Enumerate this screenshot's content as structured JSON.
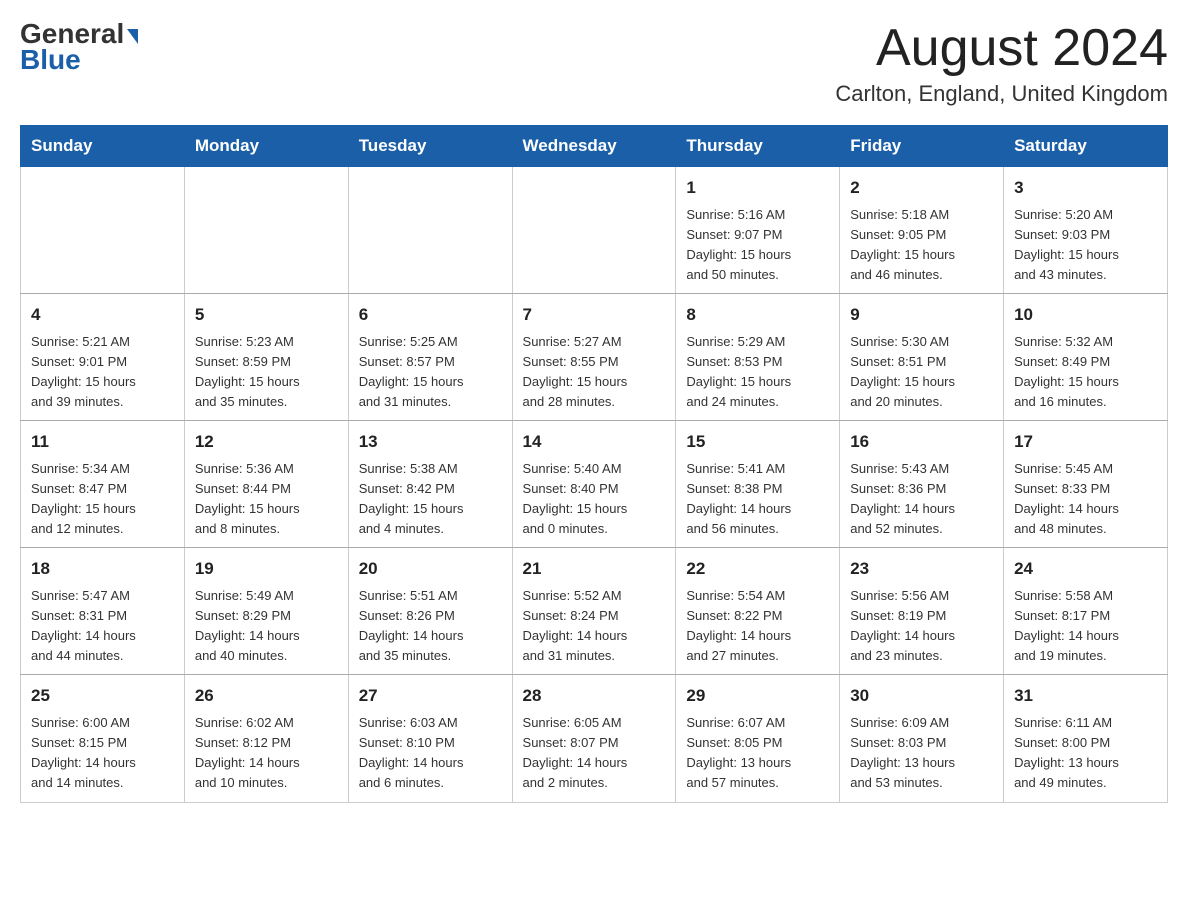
{
  "header": {
    "logo_general": "General",
    "logo_blue": "Blue",
    "month_title": "August 2024",
    "location": "Carlton, England, United Kingdom"
  },
  "days_of_week": [
    "Sunday",
    "Monday",
    "Tuesday",
    "Wednesday",
    "Thursday",
    "Friday",
    "Saturday"
  ],
  "weeks": [
    [
      {
        "day": "",
        "info": ""
      },
      {
        "day": "",
        "info": ""
      },
      {
        "day": "",
        "info": ""
      },
      {
        "day": "",
        "info": ""
      },
      {
        "day": "1",
        "info": "Sunrise: 5:16 AM\nSunset: 9:07 PM\nDaylight: 15 hours\nand 50 minutes."
      },
      {
        "day": "2",
        "info": "Sunrise: 5:18 AM\nSunset: 9:05 PM\nDaylight: 15 hours\nand 46 minutes."
      },
      {
        "day": "3",
        "info": "Sunrise: 5:20 AM\nSunset: 9:03 PM\nDaylight: 15 hours\nand 43 minutes."
      }
    ],
    [
      {
        "day": "4",
        "info": "Sunrise: 5:21 AM\nSunset: 9:01 PM\nDaylight: 15 hours\nand 39 minutes."
      },
      {
        "day": "5",
        "info": "Sunrise: 5:23 AM\nSunset: 8:59 PM\nDaylight: 15 hours\nand 35 minutes."
      },
      {
        "day": "6",
        "info": "Sunrise: 5:25 AM\nSunset: 8:57 PM\nDaylight: 15 hours\nand 31 minutes."
      },
      {
        "day": "7",
        "info": "Sunrise: 5:27 AM\nSunset: 8:55 PM\nDaylight: 15 hours\nand 28 minutes."
      },
      {
        "day": "8",
        "info": "Sunrise: 5:29 AM\nSunset: 8:53 PM\nDaylight: 15 hours\nand 24 minutes."
      },
      {
        "day": "9",
        "info": "Sunrise: 5:30 AM\nSunset: 8:51 PM\nDaylight: 15 hours\nand 20 minutes."
      },
      {
        "day": "10",
        "info": "Sunrise: 5:32 AM\nSunset: 8:49 PM\nDaylight: 15 hours\nand 16 minutes."
      }
    ],
    [
      {
        "day": "11",
        "info": "Sunrise: 5:34 AM\nSunset: 8:47 PM\nDaylight: 15 hours\nand 12 minutes."
      },
      {
        "day": "12",
        "info": "Sunrise: 5:36 AM\nSunset: 8:44 PM\nDaylight: 15 hours\nand 8 minutes."
      },
      {
        "day": "13",
        "info": "Sunrise: 5:38 AM\nSunset: 8:42 PM\nDaylight: 15 hours\nand 4 minutes."
      },
      {
        "day": "14",
        "info": "Sunrise: 5:40 AM\nSunset: 8:40 PM\nDaylight: 15 hours\nand 0 minutes."
      },
      {
        "day": "15",
        "info": "Sunrise: 5:41 AM\nSunset: 8:38 PM\nDaylight: 14 hours\nand 56 minutes."
      },
      {
        "day": "16",
        "info": "Sunrise: 5:43 AM\nSunset: 8:36 PM\nDaylight: 14 hours\nand 52 minutes."
      },
      {
        "day": "17",
        "info": "Sunrise: 5:45 AM\nSunset: 8:33 PM\nDaylight: 14 hours\nand 48 minutes."
      }
    ],
    [
      {
        "day": "18",
        "info": "Sunrise: 5:47 AM\nSunset: 8:31 PM\nDaylight: 14 hours\nand 44 minutes."
      },
      {
        "day": "19",
        "info": "Sunrise: 5:49 AM\nSunset: 8:29 PM\nDaylight: 14 hours\nand 40 minutes."
      },
      {
        "day": "20",
        "info": "Sunrise: 5:51 AM\nSunset: 8:26 PM\nDaylight: 14 hours\nand 35 minutes."
      },
      {
        "day": "21",
        "info": "Sunrise: 5:52 AM\nSunset: 8:24 PM\nDaylight: 14 hours\nand 31 minutes."
      },
      {
        "day": "22",
        "info": "Sunrise: 5:54 AM\nSunset: 8:22 PM\nDaylight: 14 hours\nand 27 minutes."
      },
      {
        "day": "23",
        "info": "Sunrise: 5:56 AM\nSunset: 8:19 PM\nDaylight: 14 hours\nand 23 minutes."
      },
      {
        "day": "24",
        "info": "Sunrise: 5:58 AM\nSunset: 8:17 PM\nDaylight: 14 hours\nand 19 minutes."
      }
    ],
    [
      {
        "day": "25",
        "info": "Sunrise: 6:00 AM\nSunset: 8:15 PM\nDaylight: 14 hours\nand 14 minutes."
      },
      {
        "day": "26",
        "info": "Sunrise: 6:02 AM\nSunset: 8:12 PM\nDaylight: 14 hours\nand 10 minutes."
      },
      {
        "day": "27",
        "info": "Sunrise: 6:03 AM\nSunset: 8:10 PM\nDaylight: 14 hours\nand 6 minutes."
      },
      {
        "day": "28",
        "info": "Sunrise: 6:05 AM\nSunset: 8:07 PM\nDaylight: 14 hours\nand 2 minutes."
      },
      {
        "day": "29",
        "info": "Sunrise: 6:07 AM\nSunset: 8:05 PM\nDaylight: 13 hours\nand 57 minutes."
      },
      {
        "day": "30",
        "info": "Sunrise: 6:09 AM\nSunset: 8:03 PM\nDaylight: 13 hours\nand 53 minutes."
      },
      {
        "day": "31",
        "info": "Sunrise: 6:11 AM\nSunset: 8:00 PM\nDaylight: 13 hours\nand 49 minutes."
      }
    ]
  ]
}
